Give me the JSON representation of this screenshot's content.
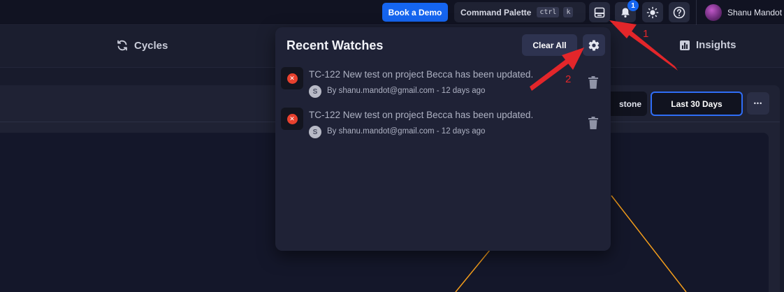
{
  "topbar": {
    "book_demo_label": "Book a Demo",
    "command_palette_label": "Command Palette",
    "shortcut_keys": [
      "ctrl",
      "k"
    ],
    "notification_count": "1",
    "user_name": "Shanu Mandot",
    "icons": [
      "monitor-icon",
      "bell-icon",
      "sun-icon",
      "help-icon"
    ]
  },
  "nav": {
    "tabs": [
      {
        "label": "Cycles",
        "icon": "refresh-icon"
      },
      {
        "label": "Insights",
        "icon": "bar-chart-icon"
      }
    ]
  },
  "card": {
    "milestone_label": "stone",
    "range_label": "Last 30 Days",
    "more_label": "•••"
  },
  "popover": {
    "title": "Recent Watches",
    "clear_all_label": "Clear All",
    "items": [
      {
        "title": "TC-122 New test on project Becca has been updated.",
        "avatar_letter": "S",
        "meta": "By shanu.mandot@gmail.com - 12 days ago"
      },
      {
        "title": "TC-122 New test on project Becca has been updated.",
        "avatar_letter": "S",
        "meta": "By shanu.mandot@gmail.com - 12 days ago"
      }
    ]
  },
  "annotations": {
    "marker_1": "1",
    "marker_2": "2"
  },
  "colors": {
    "accent_blue": "#1565f0",
    "annotation_red": "#e3262a",
    "error_red": "#e8412e",
    "chart_line_orange": "#f59e1b",
    "background": "#181b2c"
  }
}
